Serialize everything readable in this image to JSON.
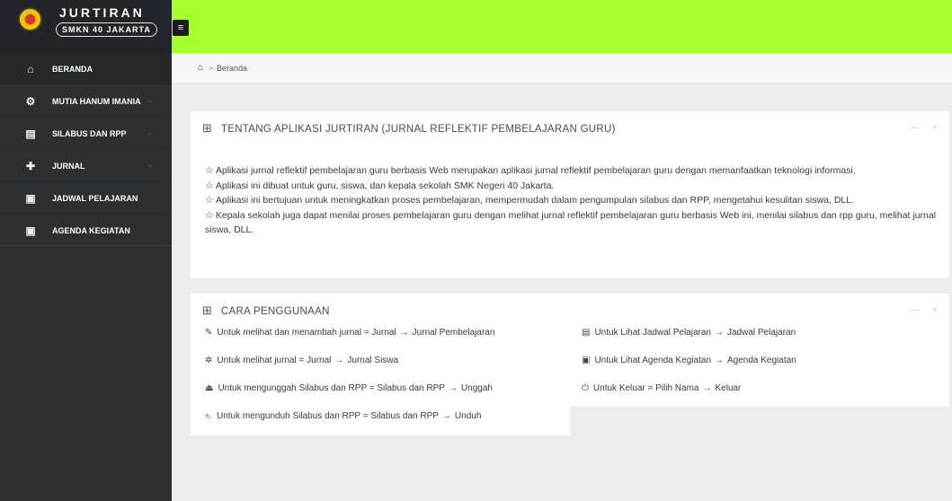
{
  "app": {
    "title": "JURTIRAN",
    "subtitle": "SMKN 40 JAKARTA"
  },
  "topbar": {
    "toggle_icon": "≡"
  },
  "sidebar": {
    "items": [
      {
        "label": "BERANDA",
        "icon": "⌂",
        "icon_name": "home-icon",
        "active": true
      },
      {
        "label": "MUTIA HANUM IMANIA",
        "icon": "⚙",
        "icon_name": "settings-icon"
      },
      {
        "label": "SILABUS DAN RPP",
        "icon": "▤",
        "icon_name": "document-icon"
      },
      {
        "label": "JURNAL",
        "icon": "✚",
        "icon_name": "journal-icon"
      },
      {
        "label": "JADWAL PELAJARAN",
        "icon": "▣",
        "icon_name": "calendar-icon"
      },
      {
        "label": "AGENDA KEGIATAN",
        "icon": "▣",
        "icon_name": "calendar-icon"
      }
    ]
  },
  "breadcrumb": {
    "home_icon": "⌂",
    "separator": ">",
    "label": "Beranda"
  },
  "about": {
    "icon": "⊞",
    "title": "TENTANG APLIKASI JURTIRAN (JURNAL REFLEKTIF PEMBELAJARAN GURU)",
    "minimize": "—",
    "close": "×",
    "lines": [
      "Aplikasi jurnal reflektif pembelajaran guru berbasis Web merupakan aplikasi jurnal reflektif pembelajaran guru dengan memanfaatkan teknologi informasi.",
      "Aplikasi ini dibuat untuk guru, siswa, dan kepala sekolah SMK Negeri 40 Jakarta.",
      "Aplikasi ini bertujuan untuk meningkatkan proses pembelajaran, mempermudah dalam pengumpulan silabus dan RPP, mengetahui kesulitan siswa, DLL.",
      "Kepala sekolah juga dapat menilai proses pembelajaran guru dengan melihat jurnal reflektif pembelajaran guru berbasis Web ini, menilai silabus dan rpp guru, melihat jurnal siswa, DLL."
    ],
    "star": "☆"
  },
  "guide": {
    "icon": "⊞",
    "title": "CARA PENGGUNAAN",
    "minimize": "—",
    "close": "×",
    "arrow": "→",
    "left": [
      {
        "icon": "✎",
        "icon_name": "pencil-icon",
        "text": "Untuk melihat dan menambah jurnal = Jurnal",
        "target": "Jurnal Pembelajaran"
      },
      {
        "icon": "✲",
        "icon_name": "users-icon",
        "text": "Untuk melihat jurnal = Jurnal",
        "target": "Jurnal Siswa"
      },
      {
        "icon": "⏏",
        "icon_name": "upload-icon",
        "text": "Untuk mengunggah Silabus dan RPP = Silabus dan RPP",
        "target": "Unggah"
      },
      {
        "icon": "⎁",
        "icon_name": "download-icon",
        "text": "Untuk mengunduh Silabus dan RPP = Silabus dan RPP",
        "target": "Unduh"
      }
    ],
    "right": [
      {
        "icon": "▤",
        "icon_name": "schedule-icon",
        "text": "Untuk Lihat Jadwal Pelajaran",
        "target": "Jadwal Pelajaran"
      },
      {
        "icon": "▣",
        "icon_name": "calendar-icon",
        "text": "Untuk Lihat Agenda Kegiatan",
        "target": "Agenda Kegiatan"
      },
      {
        "icon": "⏻",
        "icon_name": "power-icon",
        "text": "Untuk Keluar = Pilih Nama",
        "target": "Keluar"
      }
    ]
  }
}
